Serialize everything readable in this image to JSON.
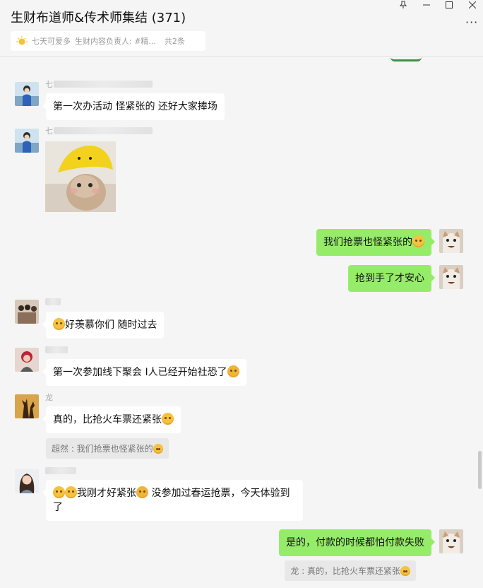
{
  "window": {
    "title": "生财布道师&传术师集结 (371)",
    "controls": [
      "pin-icon",
      "minimize-icon",
      "maximize-icon",
      "close-icon"
    ],
    "more": "···"
  },
  "notice": {
    "user": "七天可爱多",
    "text": "生财内容负责人: #精...",
    "count": "共2条"
  },
  "messages": [
    {
      "text": "第一次办活动 怪紧张的 还好大家捧场"
    },
    {
      "image": "yellow-hat-cat-photo"
    },
    {
      "text": "我们抢票也怪紧张的"
    },
    {
      "text": "抢到手了才安心"
    },
    {
      "text": "好羡慕你们 随时过去"
    },
    {
      "text": "第一次参加线下聚会 I人已经开始社恐了"
    },
    {
      "sender_initial": "龙",
      "text": "真的，比抢火车票还紧张",
      "quote": "超然 : 我们抢票也怪紧张的"
    },
    {
      "text_a": "我刚才好紧张",
      "text_b": " 没参加过春运抢票，今天体验到了"
    },
    {
      "text": "是的，付款的时候都怕付款失败",
      "quote": "龙 : 真的，比抢火车票还紧张"
    }
  ],
  "sender_initials": {
    "m1": "七",
    "m2": "七"
  },
  "colors": {
    "out_bubble": "#95ec69",
    "in_bubble": "#ffffff",
    "background": "#f5f5f5"
  }
}
